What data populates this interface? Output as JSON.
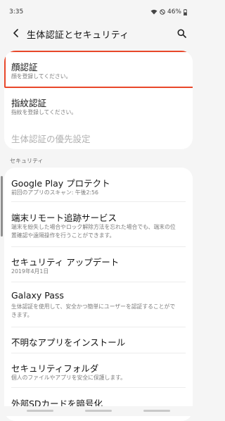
{
  "status": {
    "time": "3:35",
    "battery": "46%"
  },
  "header": {
    "title": "生体認証とセキュリティ",
    "back_icon": "back-arrow-icon",
    "search_icon": "search-icon"
  },
  "biometrics": {
    "face": {
      "title": "顔認証",
      "subtitle": "顔を登録してください。"
    },
    "fingerprint": {
      "title": "指紋認証",
      "subtitle": "指紋を登録してください。"
    },
    "priority": {
      "title": "生体認証の優先設定"
    }
  },
  "security": {
    "header": "セキュリティ",
    "items": [
      {
        "title": "Google Play プロテクト",
        "subtitle": "前回のアプリのスキャン: 午後2:56"
      },
      {
        "title": "端末リモート追跡サービス",
        "subtitle": "端末を紛失した場合やロック解除方法を忘れた場合でも、端末の位置確認や遠隔操作を行うことができます。"
      },
      {
        "title": "セキュリティ アップデート",
        "subtitle": "2019年4月1日"
      },
      {
        "title": "Galaxy Pass",
        "subtitle": "生体認証を使用して、安全かつ簡単にユーザーを認証することができます。"
      },
      {
        "title": "不明なアプリをインストール",
        "subtitle": ""
      },
      {
        "title": "セキュリティフォルダ",
        "subtitle": "個人のファイルやアプリを安全に保護します。"
      },
      {
        "title": "外部SDカードを暗号化",
        "subtitle": ""
      }
    ]
  },
  "colors": {
    "highlight": "#e8472a",
    "background": "#f5f5f5"
  }
}
